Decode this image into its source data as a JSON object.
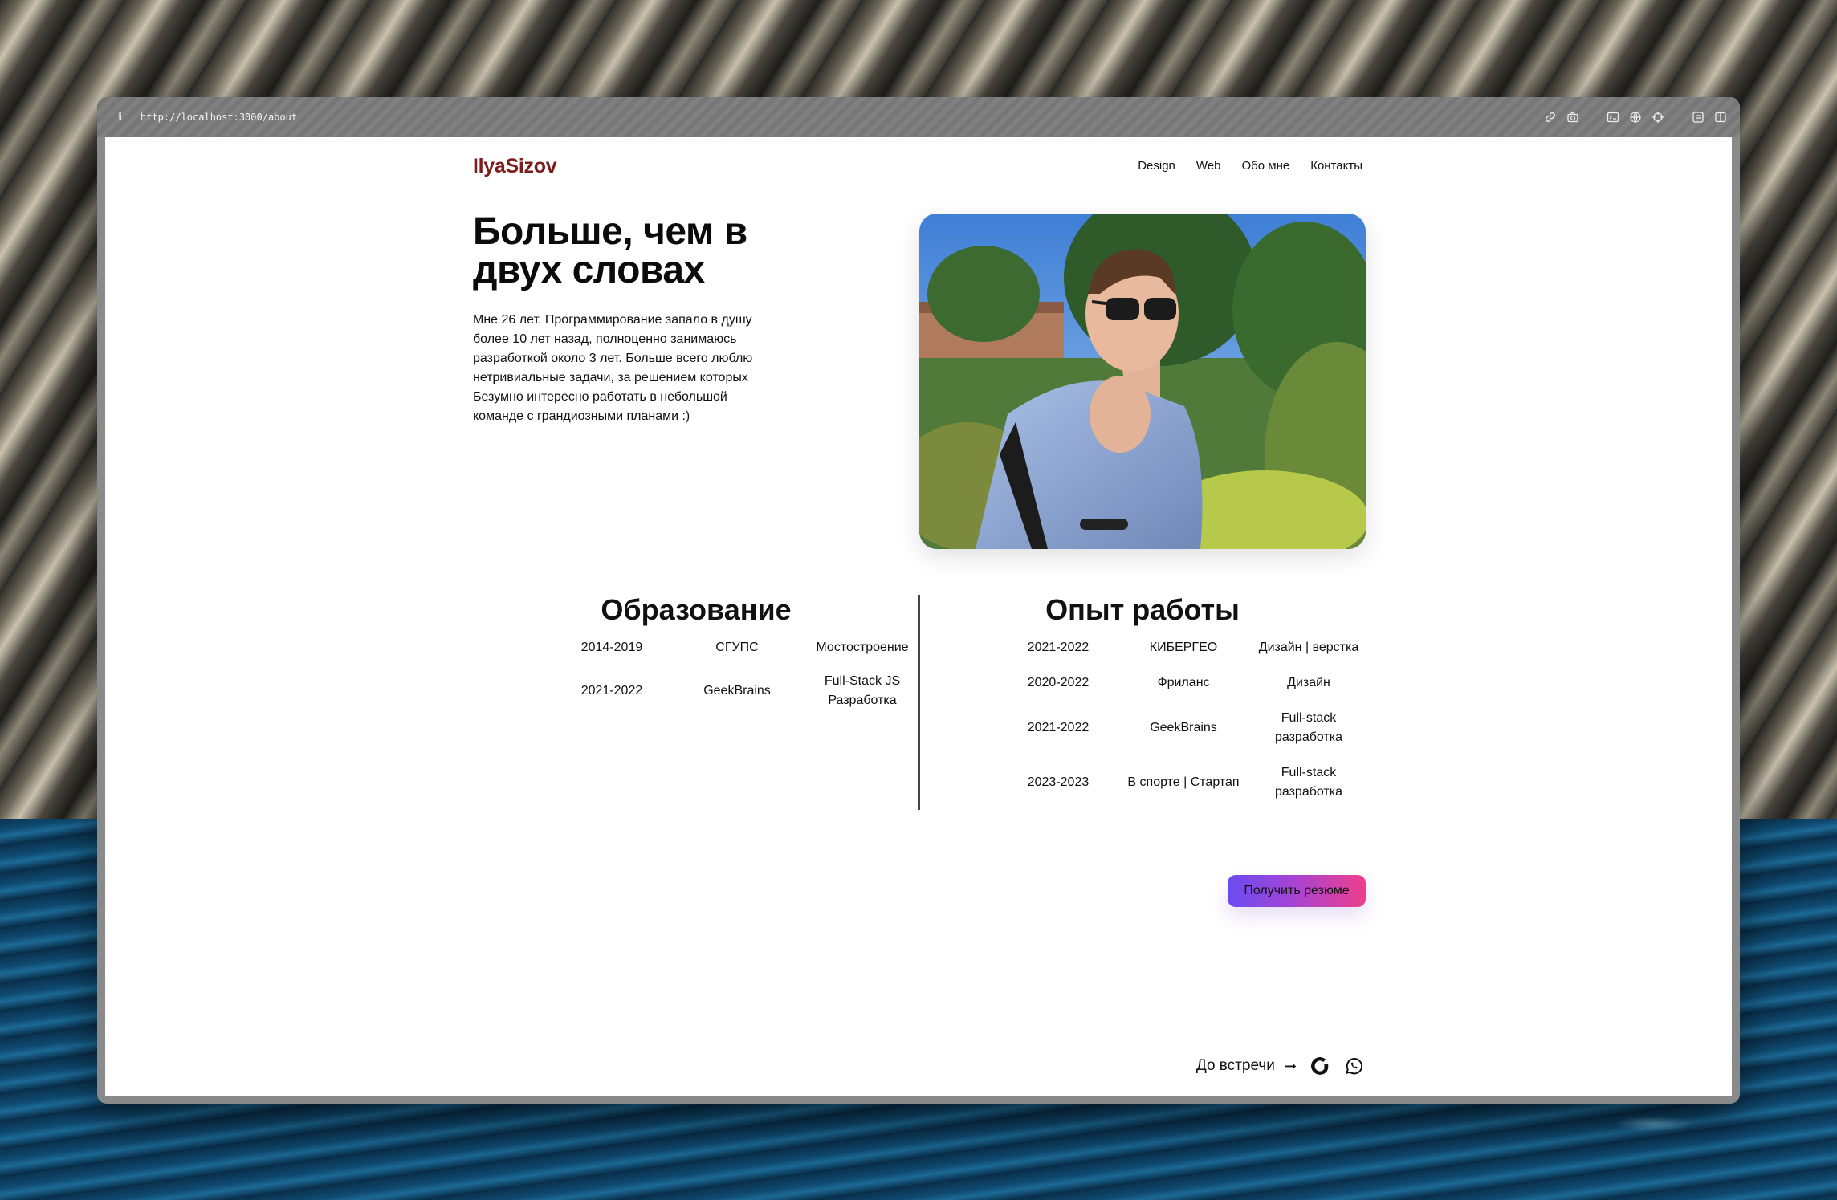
{
  "browser": {
    "url": "http://localhost:3000/about",
    "info_glyph": "i",
    "toolbar_icons": [
      "link-icon",
      "camera-icon",
      "terminal-icon",
      "globe-icon",
      "crosshair-icon",
      "panel-icon",
      "split-view-icon"
    ]
  },
  "site": {
    "logo": "IlyaSizov",
    "nav": [
      {
        "label": "Design",
        "active": false
      },
      {
        "label": "Web",
        "active": false
      },
      {
        "label": "Обо мне",
        "active": true
      },
      {
        "label": "Контакты",
        "active": false
      }
    ]
  },
  "hero": {
    "title": "Больше, чем в двух словах",
    "text": "Мне 26 лет. Программирование запало в душу более 10 лет назад, полноценно занимаюсь разработкой около 3 лет. Больше всего люблю нетривиальные задачи, за решением которых Безумно интересно работать в небольшой команде с грандиозными планами :)"
  },
  "education": {
    "title": "Образование",
    "rows": [
      [
        "2014-2019",
        "СГУПС",
        "Мостостроение"
      ],
      [
        "2021-2022",
        "GeekBrains",
        "Full-Stack JS Разработка"
      ]
    ]
  },
  "experience": {
    "title": "Опыт работы",
    "rows": [
      [
        "2021-2022",
        "КИБЕРГЕО",
        "Дизайн | верстка"
      ],
      [
        "2020-2022",
        "Фриланс",
        "Дизайн"
      ],
      [
        "2021-2022",
        "GeekBrains",
        "Full-stack разработка"
      ],
      [
        "2023-2023",
        "В спорте | Стартап",
        "Full-stack разработка"
      ]
    ]
  },
  "resume_button": "Получить резюме",
  "footer": {
    "farewell": "До встречи",
    "arrow": "➞",
    "icons": [
      "google-icon",
      "whatsapp-icon"
    ]
  },
  "colors": {
    "logo": "#7a1d1d",
    "button_gradient": [
      "#6a4cf0",
      "#ee3f8c"
    ]
  }
}
